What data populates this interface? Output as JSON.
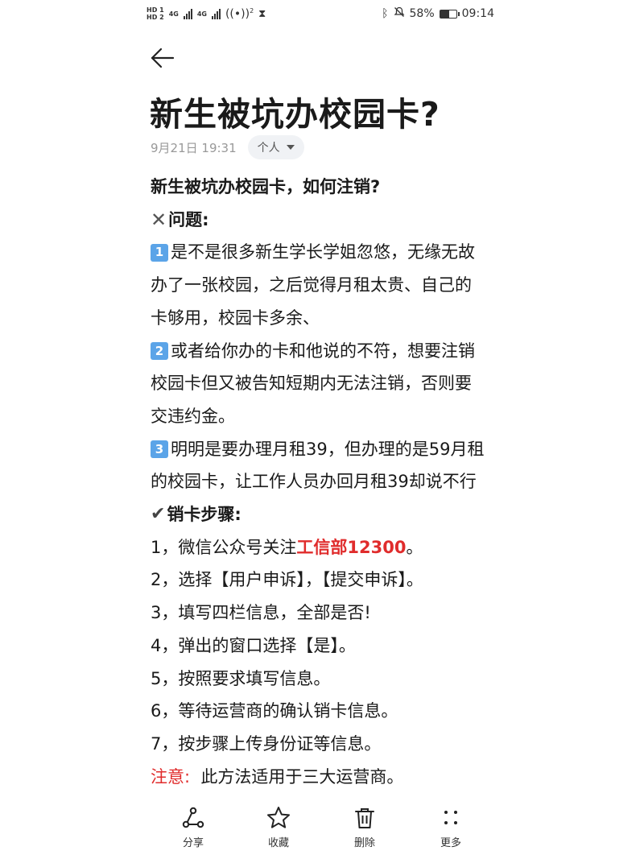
{
  "status_bar": {
    "network_top": "HD 1",
    "network_bottom": "HD 2",
    "net_type_1": "4G",
    "net_type_2": "4G",
    "hotspot": "2",
    "battery": "58%",
    "battery_level": 0.58,
    "time": "09:14"
  },
  "article": {
    "title": "新生被坑办校园卡?",
    "date": "9月21日 19:31",
    "tag": "个人"
  },
  "content": {
    "heading": "新生被坑办校园卡，如何注销?",
    "problem_mark": "✕",
    "problem_label": "问题:",
    "item1_badge": "1",
    "item1_line1": "是不是很多新生学长学姐忽悠，无缘无故",
    "item1_line2": "办了一张校园，之后觉得月租太贵、自己的",
    "item1_line3": "卡够用，校园卡多余、",
    "item2_badge": "2",
    "item2_line1": "或者给你办的卡和他说的不符，想要注销",
    "item2_line2": "校园卡但又被告知短期内无法注销，否则要",
    "item2_line3": "交违约金。",
    "item3_badge": "3",
    "item3_line1": "明明是要办理月租39，但办理的是59月租",
    "item3_line2": "的校园卡，让工作人员办回月租39却说不行",
    "steps_mark": "✔",
    "steps_label": "销卡步骤:",
    "step1_prefix": "1，微信公众号关注",
    "step1_highlight": "工信部12300",
    "step1_suffix": "。",
    "step2": "2，选择【用户申诉】，【提交申诉】。",
    "step3": "3，填写四栏信息，全部是否!",
    "step4": "4，弹出的窗口选择【是】。",
    "step5": "5，按照要求填写信息。",
    "step6": "6，等待运营商的确认销卡信息。",
    "step7": "7，按步骤上传身份证等信息。",
    "note_label": "注意:",
    "note_text": "  此方法适用于三大运营商。"
  },
  "bottom_bar": {
    "share_label": "分享",
    "favorite_label": "收藏",
    "delete_label": "删除",
    "more_label": "更多"
  },
  "colors": {
    "accent_red": "#e02c2c",
    "badge_blue": "#5ba4e8",
    "tag_bg": "#f0f2f5"
  }
}
